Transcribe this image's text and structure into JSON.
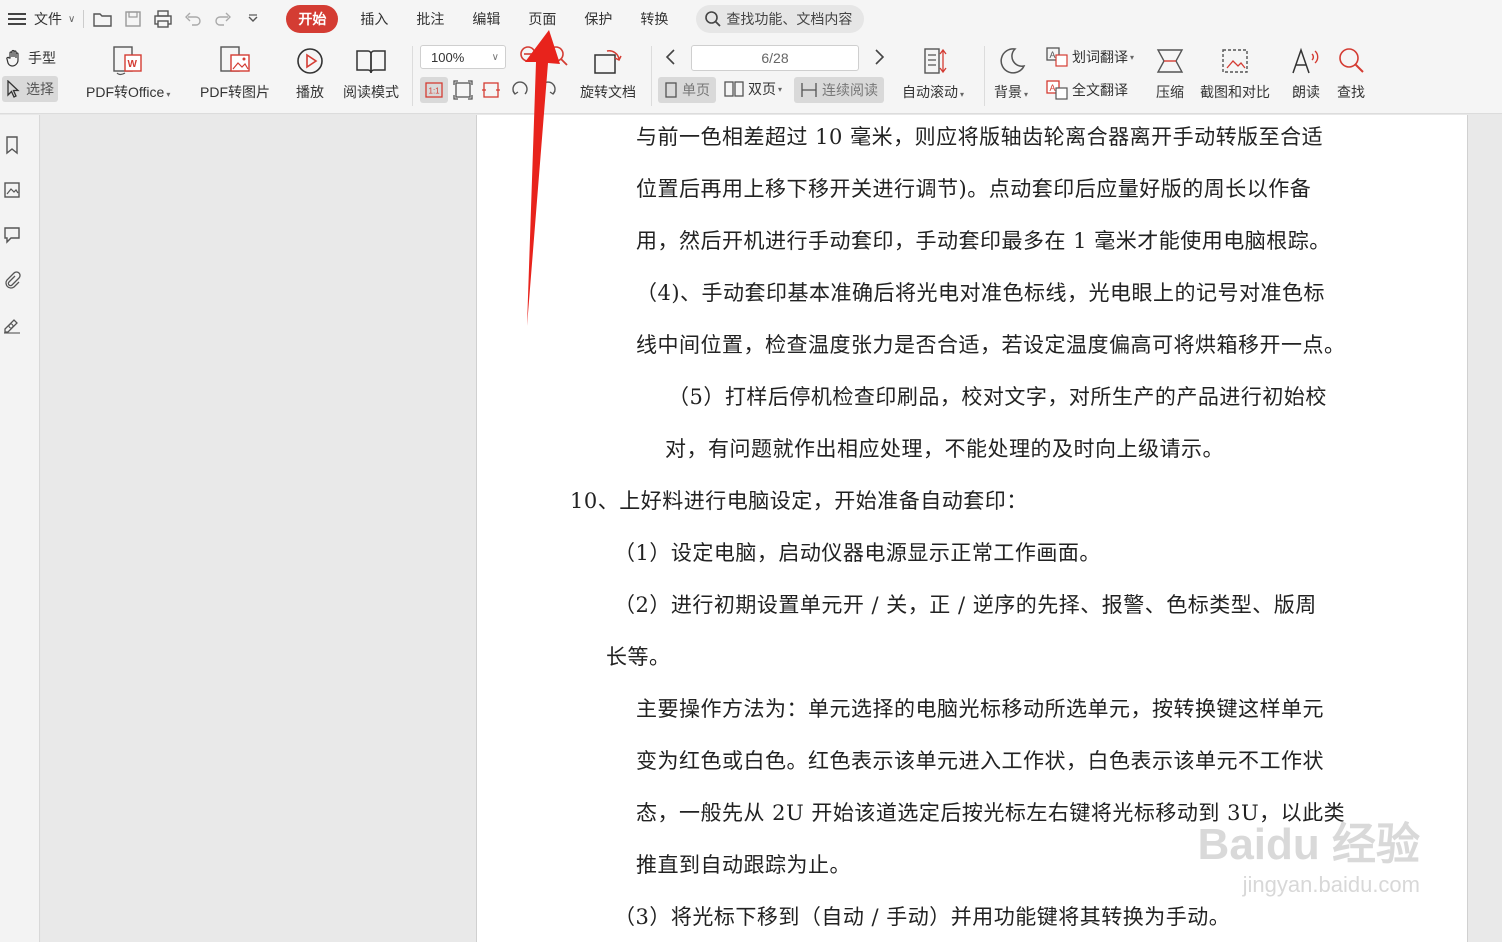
{
  "menubar": {
    "file_label": "文件",
    "tabs": [
      "开始",
      "插入",
      "批注",
      "编辑",
      "页面",
      "保护",
      "转换"
    ],
    "search_placeholder": "查找功能、文档内容"
  },
  "toolbar": {
    "hand_label": "手型",
    "select_label": "选择",
    "pdf_to_office": "PDF转Office",
    "pdf_to_image": "PDF转图片",
    "play": "播放",
    "read_mode": "阅读模式",
    "zoom": "100%",
    "rotate_doc": "旋转文档",
    "page_indicator": "6/28",
    "single_page": "单页",
    "double_page": "双页",
    "continuous_read": "连续阅读",
    "auto_scroll": "自动滚动",
    "background": "背景",
    "word_translate": "划词翻译",
    "full_translate": "全文翻译",
    "compress": "压缩",
    "screenshot_compare": "截图和对比",
    "read_aloud": "朗读",
    "find": "查找"
  },
  "document": {
    "lines": [
      "与前一色相差超过 10 毫米，则应将版轴齿轮离合器离开手动转版至合适",
      "位置后再用上移下移开关进行调节)。点动套印后应量好版的周长以作备",
      "用，然后开机进行手动套印，手动套印最多在 1 毫米才能使用电脑根踪。",
      "（4)、手动套印基本准确后将光电对准色标线，光电眼上的记号对准色标",
      "线中间位置，检查温度张力是否合适，若设定温度偏高可将烘箱移开一点。",
      "（5）打样后停机检查印刷品，校对文字，对所生产的产品进行初始校",
      "对，有问题就作出相应处理，不能处理的及时向上级请示。",
      "10、上好料进行电脑设定，开始准备自动套印：",
      "（1）设定电脑，启动仪器电源显示正常工作画面。",
      "（2）进行初期设置单元开 / 关，正 / 逆序的先择、报警、色标类型、版周",
      "长等。",
      "主要操作方法为：单元选择的电脑光标移动所选单元，按转换键这样单元",
      "变为红色或白色。红色表示该单元进入工作状，白色表示该单元不工作状",
      "态，一般先从 2U 开始该道选定后按光标左右键将光标移动到 3U，以此类",
      "推直到自动跟踪为止。",
      "（3）将光标下移到（自动 / 手动）并用功能键将其转换为手动。"
    ]
  },
  "watermark": {
    "line1": "Baidu 经验",
    "line2": "jingyan.baidu.com"
  },
  "colors": {
    "accent": "#d43c33",
    "arrow": "#e8231c"
  }
}
